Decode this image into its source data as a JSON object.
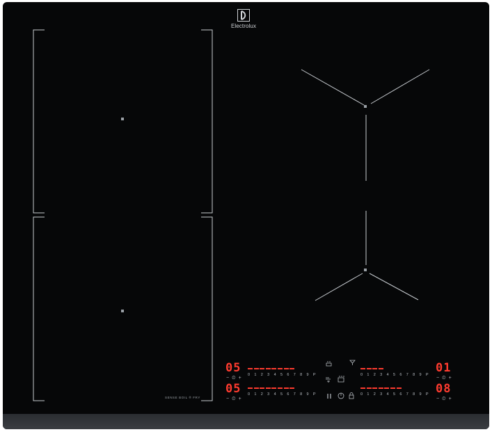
{
  "brand": {
    "name": "Electrolux"
  },
  "sense_label": "SENSE BOIL ® FRY",
  "zones": {
    "front_left": {
      "display": "05",
      "dashes": 8,
      "minus": "−",
      "timer": "⏲",
      "plus": "+"
    },
    "rear_left": {
      "display": "05",
      "dashes": 8,
      "minus": "−",
      "timer": "⏲",
      "plus": "+"
    },
    "front_right": {
      "display": "01",
      "dashes": 4,
      "minus": "−",
      "timer": "⏲",
      "plus": "+"
    },
    "rear_right": {
      "display": "08",
      "dashes": 7,
      "minus": "−",
      "timer": "⏲",
      "plus": "+"
    }
  },
  "power_scale": [
    "0",
    "1",
    "2",
    "3",
    "4",
    "5",
    "6",
    "7",
    "8",
    "9",
    "P"
  ],
  "center_icons": [
    "steam-pot-icon",
    "hob2hood-fan-icon",
    "boil-pot-icon",
    "pause-icon",
    "power-icon",
    "lock-icon",
    "timer-bars-icon",
    "sense-fry-icon"
  ],
  "colors": {
    "glass": "#060708",
    "display_red": "#ff3b2f",
    "print_grey": "#b9bec4",
    "frame": "#3a3d41"
  }
}
